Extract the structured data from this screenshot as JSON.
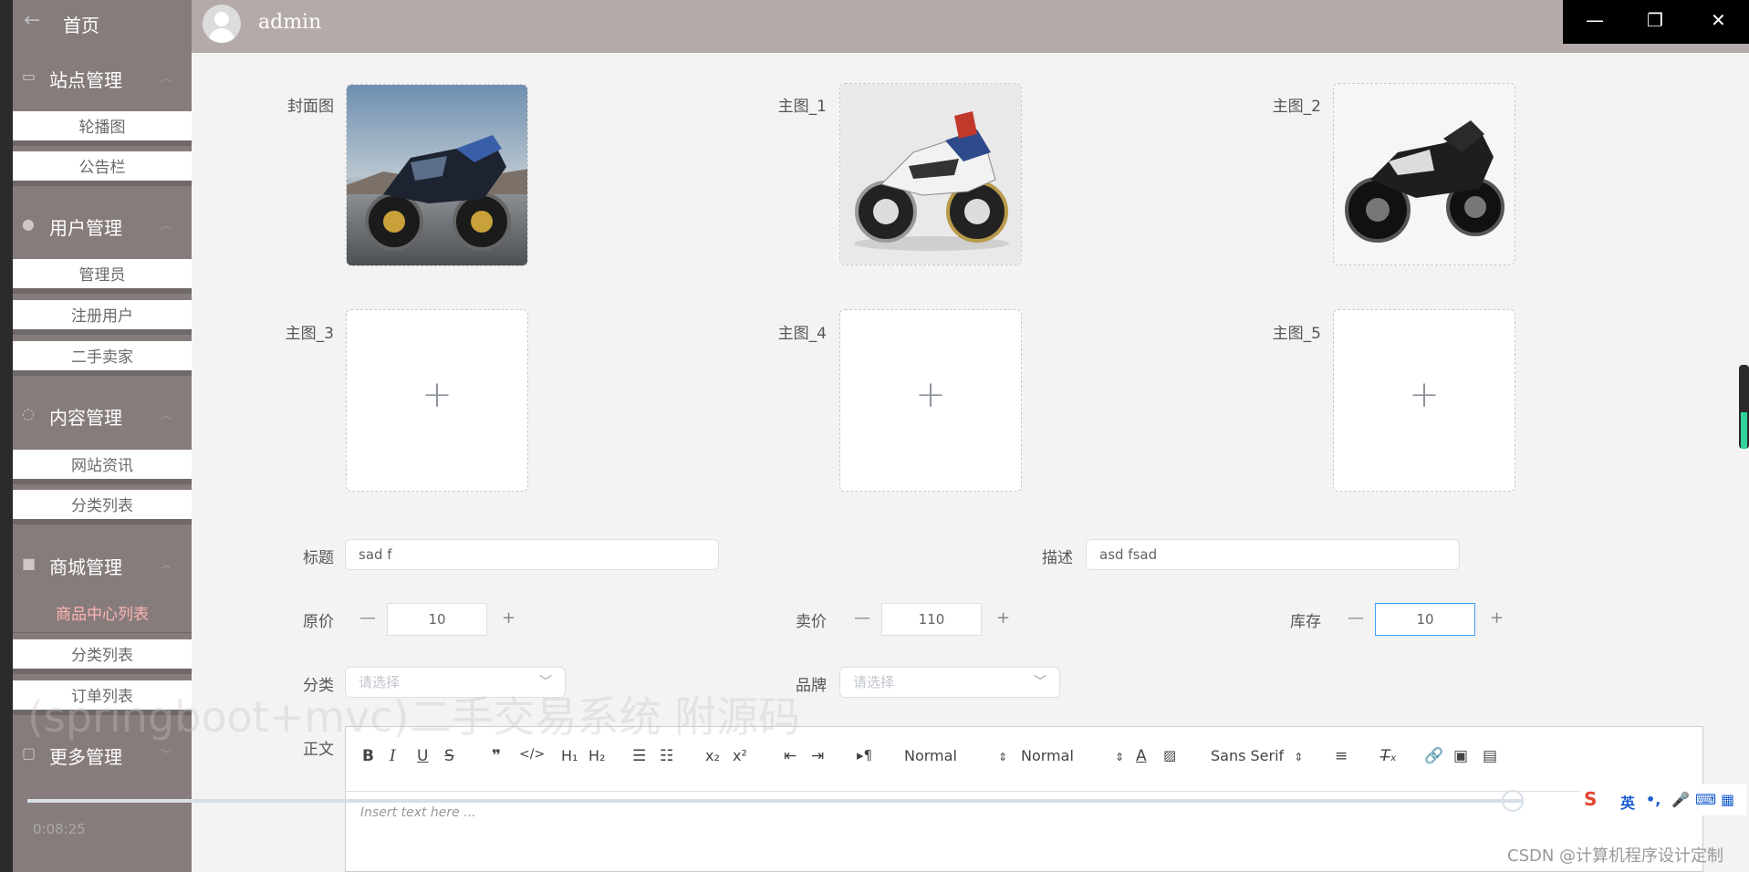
{
  "sidebar": {
    "home": "首页",
    "groups": [
      {
        "label": "站点管理",
        "icon": "monitor-icon",
        "items": [
          "轮播图",
          "公告栏"
        ]
      },
      {
        "label": "用户管理",
        "icon": "user-icon",
        "items": [
          "管理员",
          "注册用户",
          "二手卖家"
        ]
      },
      {
        "label": "内容管理",
        "icon": "chat-icon",
        "items": [
          "网站资讯",
          "分类列表"
        ]
      },
      {
        "label": "商城管理",
        "icon": "lock-icon",
        "items": [
          "商品中心列表",
          "分类列表",
          "订单列表"
        ]
      },
      {
        "label": "更多管理",
        "icon": "copy-icon",
        "items": []
      }
    ],
    "active_item": "商品中心列表"
  },
  "header": {
    "username": "admin"
  },
  "form": {
    "images": [
      {
        "label": "封面图",
        "image": "black-sport-motorcycle"
      },
      {
        "label": "主图_1",
        "image": "white-blue-adventure-motorcycle"
      },
      {
        "label": "主图_2",
        "image": "black-cruiser-motorcycle"
      },
      {
        "label": "主图_3",
        "image": ""
      },
      {
        "label": "主图_4",
        "image": ""
      },
      {
        "label": "主图_5",
        "image": ""
      }
    ],
    "title_label": "标题",
    "title_value": "sad f",
    "desc_label": "描述",
    "desc_value": "asd fsad",
    "price_label": "原价",
    "price_value": "10",
    "sale_label": "卖价",
    "sale_value": "110",
    "stock_label": "库存",
    "stock_value": "10",
    "category_label": "分类",
    "category_placeholder": "请选择",
    "brand_label": "品牌",
    "brand_placeholder": "请选择",
    "body_label": "正文"
  },
  "editor": {
    "header_select": "Normal",
    "size_select": "Normal",
    "font_select": "Sans Serif",
    "placeholder": "Insert text here ..."
  },
  "overlay": {
    "timecode": "0:08:25",
    "watermark": "CSDN @计算机程序设计定制",
    "ime_lang": "英"
  }
}
